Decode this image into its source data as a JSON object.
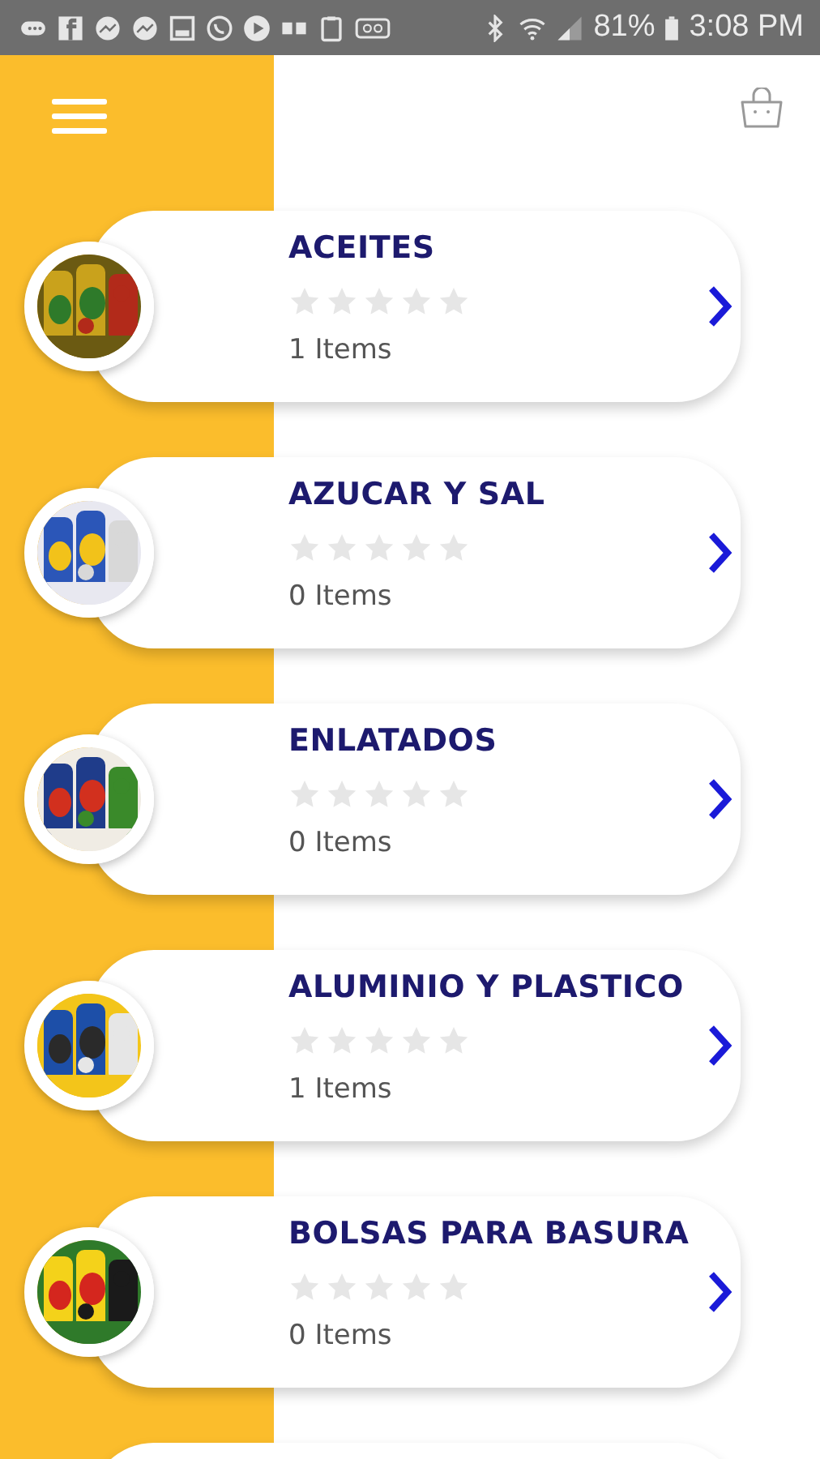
{
  "status_bar": {
    "battery": "81%",
    "time": "3:08 PM"
  },
  "categories": [
    {
      "title": "ACEITES",
      "stars": 0,
      "count": "1 Items"
    },
    {
      "title": "AZUCAR Y SAL",
      "stars": 0,
      "count": "0 Items"
    },
    {
      "title": "ENLATADOS",
      "stars": 0,
      "count": "0 Items"
    },
    {
      "title": "ALUMINIO Y PLASTICO",
      "stars": 0,
      "count": "1 Items"
    },
    {
      "title": "BOLSAS PARA BASURA",
      "stars": 0,
      "count": "0 Items"
    }
  ]
}
